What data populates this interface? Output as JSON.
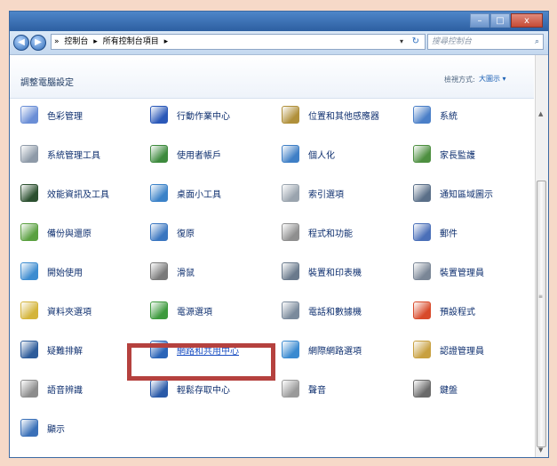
{
  "window": {
    "minimize": "–",
    "maximize": "□",
    "close": "x"
  },
  "address": {
    "back": "◀",
    "forward": "▶",
    "path_root": "»",
    "seg1": "控制台",
    "seg2": "所有控制台項目",
    "sep": "▸",
    "dropdown": "▾",
    "refresh": "↻"
  },
  "search": {
    "placeholder": "搜尋控制台",
    "icon": "⌕"
  },
  "header": {
    "title": "調整電腦設定",
    "view_by": "檢視方式:",
    "view_value": "大圖示 ▾"
  },
  "items": [
    {
      "label": "色彩管理",
      "color": "#6a8ed6"
    },
    {
      "label": "行動作業中心",
      "color": "#2a58b8"
    },
    {
      "label": "位置和其他感應器",
      "color": "#b0903a"
    },
    {
      "label": "系統",
      "color": "#4a7fc8"
    },
    {
      "label": "系統管理工具",
      "color": "#8e9aa8"
    },
    {
      "label": "使用者帳戶",
      "color": "#3d8a3d"
    },
    {
      "label": "個人化",
      "color": "#3f7fc6"
    },
    {
      "label": "家長監護",
      "color": "#4d8f40"
    },
    {
      "label": "效能資訊及工具",
      "color": "#2c5030"
    },
    {
      "label": "桌面小工具",
      "color": "#3b82c8"
    },
    {
      "label": "索引選項",
      "color": "#9aa4ae"
    },
    {
      "label": "通知區域圖示",
      "color": "#5a6f88"
    },
    {
      "label": "備份與還原",
      "color": "#5aa040"
    },
    {
      "label": "復原",
      "color": "#3a76c0"
    },
    {
      "label": "程式和功能",
      "color": "#8f8f8f"
    },
    {
      "label": "郵件",
      "color": "#4a6fb8"
    },
    {
      "label": "開始使用",
      "color": "#3d8cd0"
    },
    {
      "label": "滑鼠",
      "color": "#7a7a7a"
    },
    {
      "label": "裝置和印表機",
      "color": "#6a7a8c"
    },
    {
      "label": "裝置管理員",
      "color": "#7a8696"
    },
    {
      "label": "資料夾選項",
      "color": "#d4b43a"
    },
    {
      "label": "電源選項",
      "color": "#3d9a3d"
    },
    {
      "label": "電話和數據機",
      "color": "#7a8a9c"
    },
    {
      "label": "預設程式",
      "color": "#d84a2a"
    },
    {
      "label": "疑難排解",
      "color": "#2e5c9a"
    },
    {
      "label": "網路和共用中心",
      "color": "#2a64b8"
    },
    {
      "label": "網際網路選項",
      "color": "#3a8ad0"
    },
    {
      "label": "認證管理員",
      "color": "#c8a040"
    },
    {
      "label": "語音辨識",
      "color": "#8c8c8c"
    },
    {
      "label": "輕鬆存取中心",
      "color": "#2a5aa8"
    },
    {
      "label": "聲音",
      "color": "#9a9a9a"
    },
    {
      "label": "鍵盤",
      "color": "#6a6a6a"
    },
    {
      "label": "顯示",
      "color": "#3a70b8"
    }
  ],
  "scrollbar": {
    "up": "▲",
    "down": "▼",
    "grip": "≡"
  }
}
